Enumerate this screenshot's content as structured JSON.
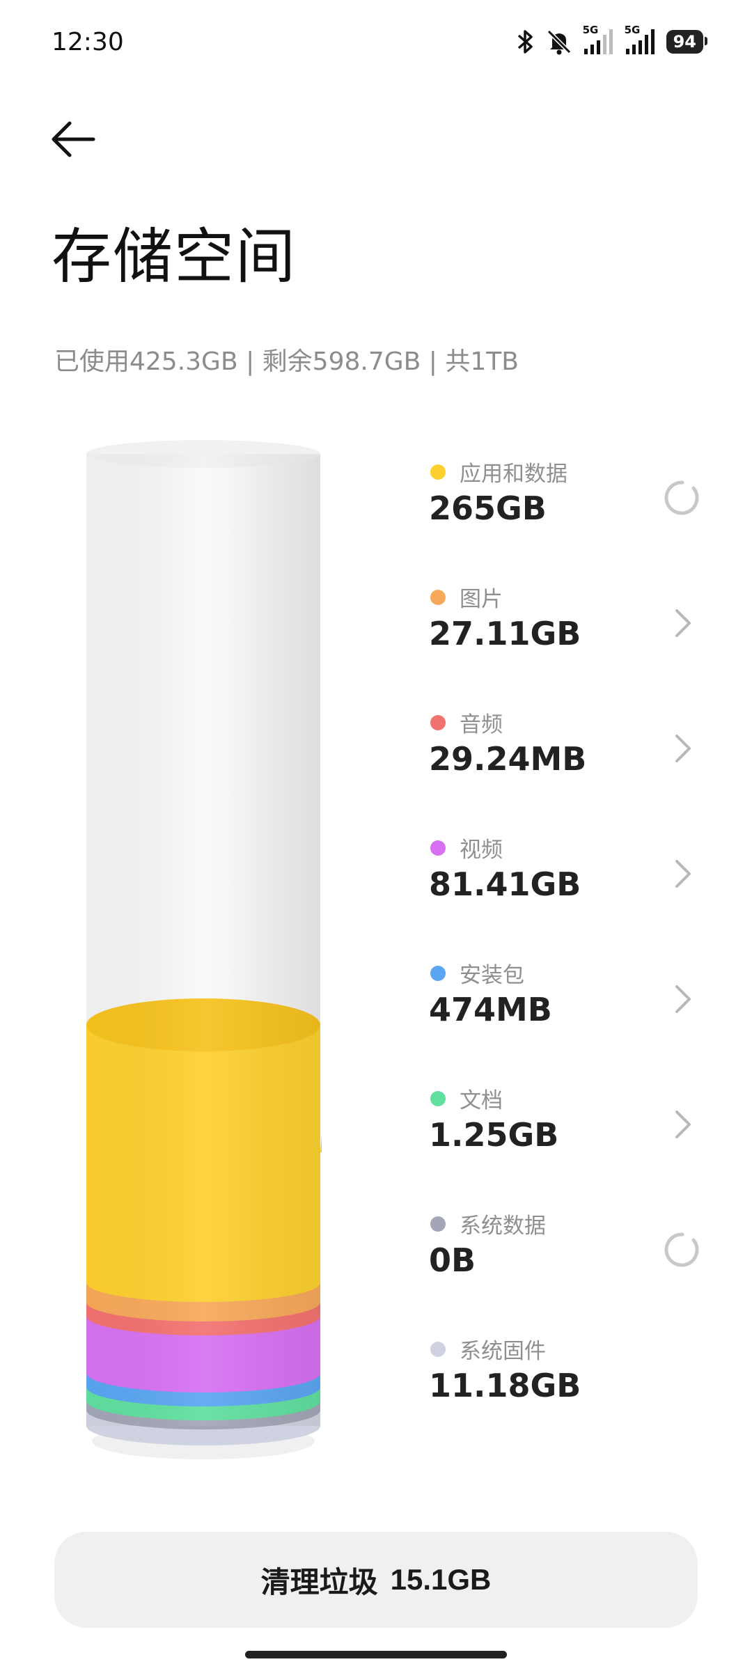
{
  "status_bar": {
    "time": "12:30",
    "network_1": "5G",
    "network_2": "5G",
    "battery": "94",
    "icons": [
      "bluetooth-icon",
      "mute-icon",
      "signal-icon",
      "signal-icon",
      "battery-icon"
    ]
  },
  "header": {
    "back_icon": "arrow-left-icon",
    "title": "存储空间",
    "summary": "已使用425.3GB | 剩余598.7GB | 共1TB"
  },
  "storage_categories": [
    {
      "name": "应用和数据",
      "value": "265GB",
      "color": "#fdd02f",
      "action": "loading-icon"
    },
    {
      "name": "图片",
      "value": "27.11GB",
      "color": "#f7a95a",
      "action": "chevron-right-icon"
    },
    {
      "name": "音频",
      "value": "29.24MB",
      "color": "#f2726f",
      "action": "chevron-right-icon"
    },
    {
      "name": "视频",
      "value": "81.41GB",
      "color": "#d771f2",
      "action": "chevron-right-icon"
    },
    {
      "name": "安装包",
      "value": "474MB",
      "color": "#5aa6f2",
      "action": "chevron-right-icon"
    },
    {
      "name": "文档",
      "value": "1.25GB",
      "color": "#60df9f",
      "action": "chevron-right-icon"
    },
    {
      "name": "系统数据",
      "value": "0B",
      "color": "#a2a6b6",
      "action": "loading-icon"
    },
    {
      "name": "系统固件",
      "value": "11.18GB",
      "color": "#cfd2e0",
      "action": "none"
    }
  ],
  "clean_button": {
    "label": "清理垃圾",
    "size": "15.1GB"
  }
}
